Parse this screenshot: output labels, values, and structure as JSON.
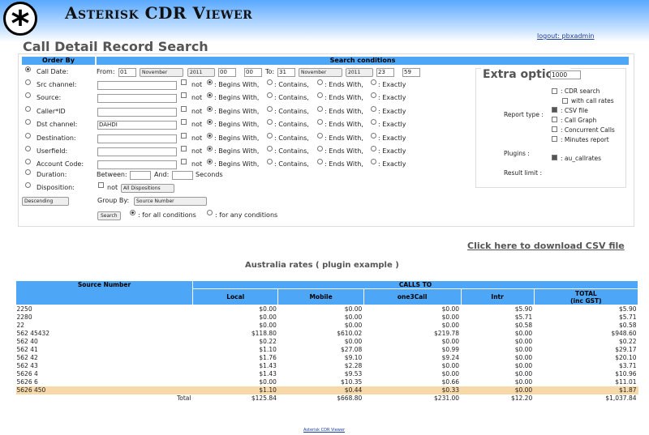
{
  "app": {
    "title": "Asterisk CDR Viewer",
    "logo_glyph": "*"
  },
  "logout": {
    "prefix": "logout:",
    "user": "pbxadmin"
  },
  "page_title": "Call Detail Record Search",
  "columns": {
    "order_by": "Order By",
    "search_conditions": "Search conditions"
  },
  "call_date": {
    "label": "Call Date:",
    "from_label": "From:",
    "from_day": "01",
    "from_month": "November",
    "from_year": "2011",
    "from_h": "00",
    "from_m": "00",
    "to_label": "To:",
    "to_day": "31",
    "to_month": "November",
    "to_year": "2011",
    "to_h": "23",
    "to_m": "59"
  },
  "fields": [
    {
      "label": "Src channel:",
      "value": ""
    },
    {
      "label": "Source:",
      "value": ""
    },
    {
      "label": "Caller*ID",
      "value": ""
    },
    {
      "label": "Dst channel:",
      "value": "DAHDI"
    },
    {
      "label": "Destination:",
      "value": ""
    },
    {
      "label": "Userfield:",
      "value": ""
    },
    {
      "label": "Account Code:",
      "value": ""
    }
  ],
  "match": {
    "not": "not",
    "begins": ": Begins With,",
    "contains": ": Contains,",
    "ends": ": Ends With,",
    "exactly": ": Exactly"
  },
  "duration": {
    "label": "Duration:",
    "between": "Between:",
    "and": "And:",
    "seconds": "Seconds"
  },
  "disposition": {
    "label": "Disposition:",
    "not": "not",
    "value": "All Dispositions"
  },
  "order": {
    "direction": "Descending",
    "group_by_label": "Group By:",
    "group_by_value": "Source Number"
  },
  "search": {
    "button": "Search",
    "all": ": for all conditions",
    "any": ": for any conditions"
  },
  "extra": {
    "title": "Extra options",
    "cdr_search": ": CDR search",
    "with_call_rates": "with call rates",
    "report_type_label": "Report type :",
    "csv_file": ": CSV file",
    "call_graph": ": Call Graph",
    "concurrent_calls": ": Concurrent Calls",
    "minutes_report": ": Minutes report",
    "plugins_label": "Plugins :",
    "au_callrates": ": au_callrates",
    "result_limit_label": "Result limit :",
    "result_limit_value": "1000"
  },
  "csv_link": "Click here to download CSV file",
  "rates": {
    "title": "Australia rates ( plugin example )",
    "headers": {
      "source": "Source Number",
      "calls_to": "CALLS TO",
      "local": "Local",
      "mobile": "Mobile",
      "one3call": "one3Call",
      "intr": "Intr",
      "total": "TOTAL",
      "total_sub": "(inc GST)"
    },
    "rows": [
      {
        "src": "2250",
        "local": "$0.00",
        "mobile": "$0.00",
        "one3call": "$0.00",
        "intr": "$5.90",
        "total": "$5.90"
      },
      {
        "src": "2280",
        "local": "$0.00",
        "mobile": "$0.00",
        "one3call": "$0.00",
        "intr": "$5.71",
        "total": "$5.71"
      },
      {
        "src": "22",
        "local": "$0.00",
        "mobile": "$0.00",
        "one3call": "$0.00",
        "intr": "$0.58",
        "total": "$0.58"
      },
      {
        "src": "562 45432",
        "local": "$118.80",
        "mobile": "$610.02",
        "one3call": "$219.78",
        "intr": "$0.00",
        "total": "$948.60"
      },
      {
        "src": "562 40",
        "local": "$0.22",
        "mobile": "$0.00",
        "one3call": "$0.00",
        "intr": "$0.00",
        "total": "$0.22"
      },
      {
        "src": "562 41",
        "local": "$1.10",
        "mobile": "$27.08",
        "one3call": "$0.99",
        "intr": "$0.00",
        "total": "$29.17"
      },
      {
        "src": "562 42",
        "local": "$1.76",
        "mobile": "$9.10",
        "one3call": "$9.24",
        "intr": "$0.00",
        "total": "$20.10"
      },
      {
        "src": "562 43",
        "local": "$1.43",
        "mobile": "$2.28",
        "one3call": "$0.00",
        "intr": "$0.00",
        "total": "$3.71"
      },
      {
        "src": "5626 4",
        "local": "$1.43",
        "mobile": "$9.53",
        "one3call": "$0.00",
        "intr": "$0.00",
        "total": "$10.96"
      },
      {
        "src": "5626 6",
        "local": "$0.00",
        "mobile": "$10.35",
        "one3call": "$0.66",
        "intr": "$0.00",
        "total": "$11.01"
      },
      {
        "src": "5626 450",
        "local": "$1.10",
        "mobile": "$0.44",
        "one3call": "$0.33",
        "intr": "$0.00",
        "total": "$1.87"
      }
    ],
    "total": {
      "label": "Total",
      "local": "$125.84",
      "mobile": "$668.80",
      "one3call": "$231.00",
      "intr": "$12.20",
      "total": "$1,037.84"
    }
  },
  "footer": "Asterisk CDR Viewer"
}
